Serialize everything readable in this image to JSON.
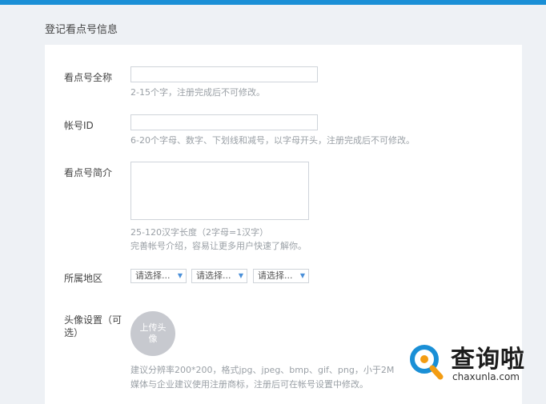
{
  "page": {
    "title": "登记看点号信息"
  },
  "form": {
    "name_label": "看点号全称",
    "name_value": "",
    "name_hint": "2-15个字，注册完成后不可修改。",
    "account_label": "帐号ID",
    "account_value": "",
    "account_hint": "6-20个字母、数字、下划线和减号，以字母开头，注册完成后不可修改。",
    "intro_label": "看点号简介",
    "intro_value": "",
    "intro_hint_1": "25-120汉字长度（2字母=1汉字）",
    "intro_hint_2": "完善帐号介绍，容易让更多用户快速了解你。",
    "region_label": "所属地区",
    "region_selects": [
      "请选择...",
      "请选择...",
      "请选择..."
    ],
    "avatar_label_1": "头像设置（可",
    "avatar_label_2": "选）",
    "avatar_button_1": "上传头",
    "avatar_button_2": "像",
    "avatar_hint_1": "建议分辨率200*200，格式jpg、jpeg、bmp、gif、png，小于2M",
    "avatar_hint_2": "媒体与企业建议使用注册商标，注册后可在帐号设置中修改。"
  },
  "watermark": {
    "text": "查询啦",
    "sub": "chaxunla.com"
  },
  "colors": {
    "accent": "#1a8fd6",
    "background": "#eef1f5",
    "hint": "#9aa0a6"
  }
}
